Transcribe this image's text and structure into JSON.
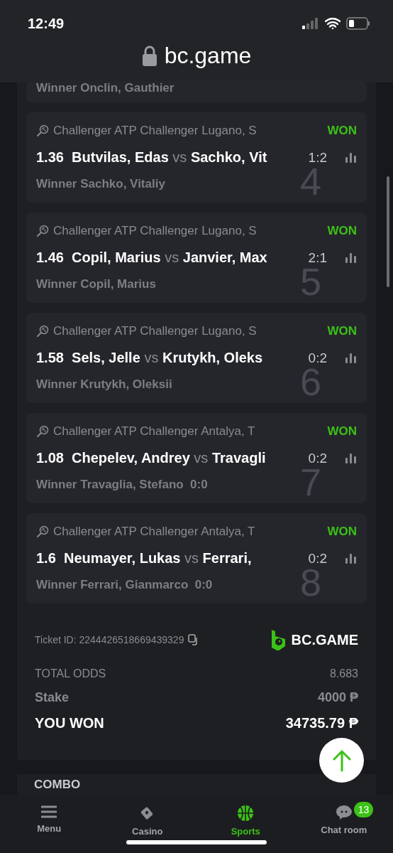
{
  "status_bar": {
    "time": "12:49"
  },
  "url_bar": {
    "address": "bc.game"
  },
  "partial_bet": {
    "winner": "Winner Onclin, Gauthier"
  },
  "bets": [
    {
      "league": "Challenger ATP Challenger Lugano, S",
      "status": "WON",
      "odds": "1.36",
      "home": "Butvilas, Edas",
      "vs": "vs",
      "away": "Sachko, Vit",
      "score": "1:2",
      "winner": "Winner Sachko, Vitaliy",
      "number": "4"
    },
    {
      "league": "Challenger ATP Challenger Lugano, S",
      "status": "WON",
      "odds": "1.46",
      "home": "Copil, Marius",
      "vs": "vs",
      "away": "Janvier, Max",
      "score": "2:1",
      "winner": "Winner Copil, Marius",
      "number": "5"
    },
    {
      "league": "Challenger ATP Challenger Lugano, S",
      "status": "WON",
      "odds": "1.58",
      "home": "Sels, Jelle",
      "vs": "vs",
      "away": "Krutykh, Oleks",
      "score": "0:2",
      "winner": "Winner Krutykh, Oleksii",
      "number": "6"
    },
    {
      "league": "Challenger ATP Challenger Antalya, T",
      "status": "WON",
      "odds": "1.08",
      "home": "Chepelev, Andrey",
      "vs": "vs",
      "away": "Travagli",
      "score": "0:2",
      "winner": "Winner Travaglia, Stefano  0:0",
      "number": "7"
    },
    {
      "league": "Challenger ATP Challenger Antalya, T",
      "status": "WON",
      "odds": "1.6",
      "home": "Neumayer, Lukas",
      "vs": "vs",
      "away": "Ferrari,",
      "score": "0:2",
      "winner": "Winner Ferrari, Gianmarco  0:0",
      "number": "8"
    }
  ],
  "ticket": {
    "id": "Ticket ID: 2244426518669439329",
    "brand": "BC.GAME"
  },
  "summary": [
    {
      "kind": "odds",
      "label": "TOTAL ODDS",
      "value": "8.683"
    },
    {
      "kind": "stake",
      "label": "Stake",
      "value": "4000 ₱"
    },
    {
      "kind": "won",
      "label": "YOU WON",
      "value": "34735.79 ₱"
    }
  ],
  "next_section": {
    "title": "COMBO"
  },
  "bottom_nav": [
    {
      "label": "Menu",
      "selected": false
    },
    {
      "label": "Casino",
      "selected": false
    },
    {
      "label": "Sports",
      "selected": true
    },
    {
      "label": "Chat room",
      "selected": false,
      "badge": "13"
    }
  ]
}
